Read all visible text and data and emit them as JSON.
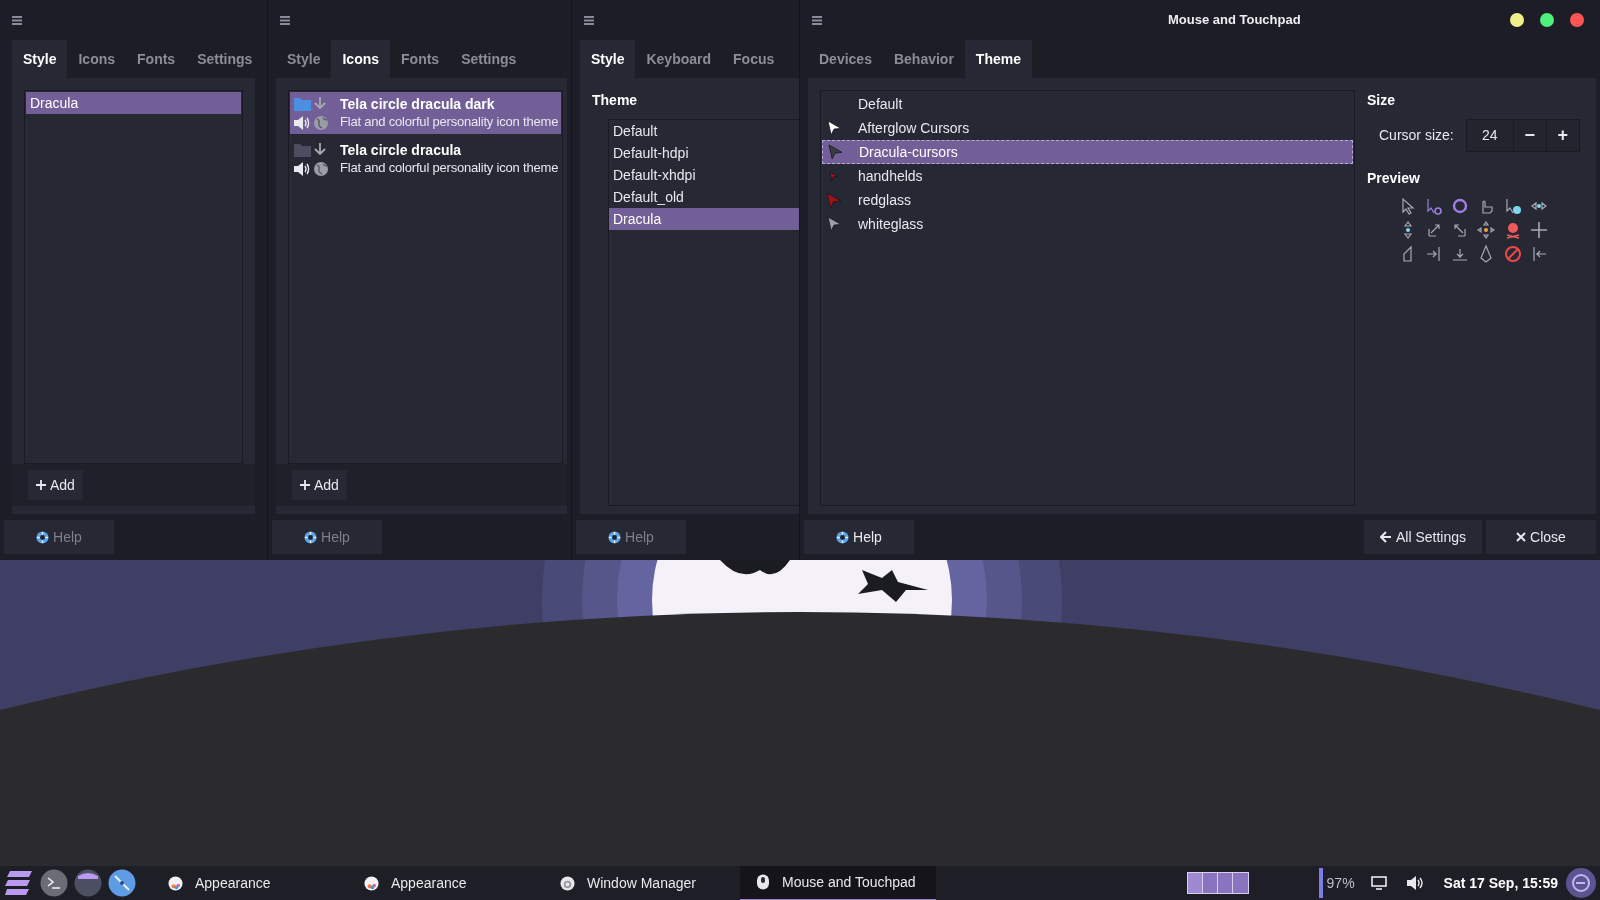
{
  "style_window": {
    "focused": false,
    "tabs": [
      {
        "label": "Style",
        "selected": true
      },
      {
        "label": "Icons",
        "selected": false
      },
      {
        "label": "Fonts",
        "selected": false
      },
      {
        "label": "Settings",
        "selected": false
      }
    ],
    "themes": [
      {
        "name": "Dracula",
        "selected": true
      }
    ],
    "add_button": "Add",
    "help_button": "Help"
  },
  "icons_window": {
    "focused": false,
    "tabs": [
      {
        "label": "Style",
        "selected": false
      },
      {
        "label": "Icons",
        "selected": true
      },
      {
        "label": "Fonts",
        "selected": false
      },
      {
        "label": "Settings",
        "selected": false
      }
    ],
    "themes": [
      {
        "name": "Tela circle dracula dark",
        "description": "Flat and colorful personality icon theme",
        "selected": true,
        "color": "#4a8fe0"
      },
      {
        "name": "Tela circle dracula",
        "description": "Flat and colorful personality icon theme",
        "selected": false,
        "color": "#4c4e60"
      }
    ],
    "add_button": "Add",
    "help_button": "Help"
  },
  "wm_window": {
    "focused": false,
    "tabs": [
      {
        "label": "Style",
        "selected": true
      },
      {
        "label": "Keyboard",
        "selected": false
      },
      {
        "label": "Focus",
        "selected": false
      }
    ],
    "theme_heading": "Theme",
    "themes": [
      {
        "name": "Default",
        "selected": false
      },
      {
        "name": "Default-hdpi",
        "selected": false
      },
      {
        "name": "Default-xhdpi",
        "selected": false
      },
      {
        "name": "Default_old",
        "selected": false
      },
      {
        "name": "Dracula",
        "selected": true
      }
    ],
    "help_button": "Help"
  },
  "mouse_window": {
    "focused": true,
    "title": "Mouse and Touchpad",
    "tabs": [
      {
        "label": "Devices",
        "selected": false
      },
      {
        "label": "Behavior",
        "selected": false
      },
      {
        "label": "Theme",
        "selected": true
      }
    ],
    "cursor_themes": [
      {
        "name": "Default",
        "selected": false,
        "kind": "none"
      },
      {
        "name": "Afterglow Cursors",
        "selected": false,
        "kind": "white"
      },
      {
        "name": "Dracula-cursors",
        "selected": true,
        "kind": "dark"
      },
      {
        "name": "handhelds",
        "selected": false,
        "kind": "small-red"
      },
      {
        "name": "redglass",
        "selected": false,
        "kind": "red"
      },
      {
        "name": "whiteglass",
        "selected": false,
        "kind": "grey"
      }
    ],
    "size_heading": "Size",
    "cursor_size_label": "Cursor size:",
    "cursor_size": "24",
    "minus": "−",
    "plus": "+",
    "preview_heading": "Preview",
    "help_button": "Help",
    "all_settings_button": "All Settings",
    "close_button": "Close"
  },
  "taskbar": {
    "tasks": [
      {
        "label": "Appearance",
        "selected": false,
        "kind": "appearance"
      },
      {
        "label": "Appearance",
        "selected": false,
        "kind": "appearance"
      },
      {
        "label": "Window Manager",
        "selected": false,
        "kind": "window-manager"
      },
      {
        "label": "Mouse and Touchpad",
        "selected": true,
        "kind": "mouse"
      }
    ],
    "battery": "97%",
    "clock": "Sat 17 Sep, 15:59"
  }
}
